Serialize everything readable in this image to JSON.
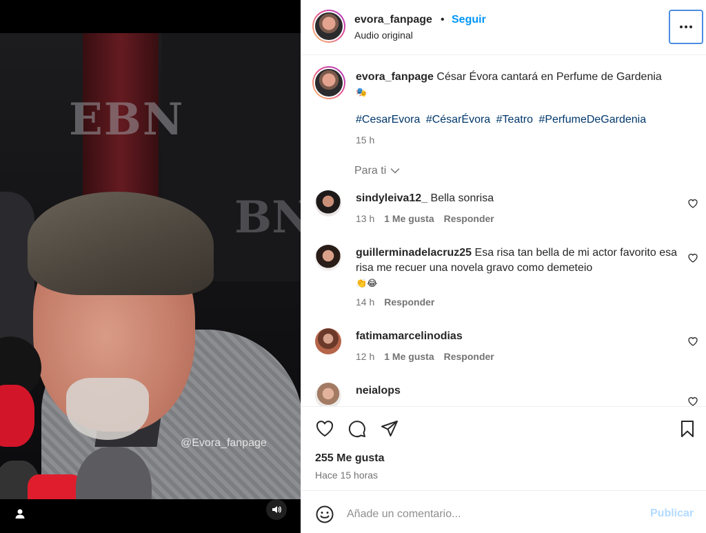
{
  "media": {
    "watermark": "@Evora_fanpage",
    "backdrop_logo": "EBN",
    "user_tag_icon": "user-tag-icon",
    "sound_icon": "speaker-icon"
  },
  "header": {
    "username": "evora_fanpage",
    "separator": "•",
    "follow_label": "Seguir",
    "audio_label": "Audio original",
    "more_icon": "more-dots-icon"
  },
  "caption": {
    "username": "evora_fanpage",
    "text": "César Évora cantará en Perfume de Gardenia",
    "emoji": "🎭",
    "hashtags": [
      "#CesarEvora",
      "#CésarÉvora",
      "#Teatro",
      "#PerfumeDeGardenia"
    ],
    "time": "15 h"
  },
  "sort": {
    "label": "Para ti",
    "icon": "chevron-down-icon"
  },
  "comments": [
    {
      "username": "sindyleiva12_",
      "text": "Bella sonrisa",
      "time": "13 h",
      "likes": "1 Me gusta",
      "reply": "Responder"
    },
    {
      "username": "guillerminadelacruz25",
      "text": "Esa risa tan bella de mi actor favorito esa risa me recuer una novela gravo como demeteio",
      "emoji": "👏😂",
      "time": "14 h",
      "likes": "",
      "reply": "Responder"
    },
    {
      "username": "fatimamarcelinodias",
      "text": "",
      "time": "12 h",
      "likes": "1 Me gusta",
      "reply": "Responder"
    },
    {
      "username": "neialops",
      "text": "",
      "time": "",
      "likes": "",
      "reply": ""
    }
  ],
  "actions": {
    "like_icon": "heart-icon",
    "comment_icon": "comment-bubble-icon",
    "share_icon": "send-icon",
    "save_icon": "bookmark-icon",
    "likes_count": "255 Me gusta",
    "posted": "Hace 15 horas"
  },
  "compose": {
    "emoji_icon": "smiley-icon",
    "placeholder": "Añade un comentario...",
    "publish_label": "Publicar"
  },
  "colors": {
    "link_blue": "#0095f6",
    "hashtag_blue": "#00376b",
    "muted": "#737373",
    "publish_disabled": "#b3dbff",
    "focus_ring": "#4b8de2"
  }
}
